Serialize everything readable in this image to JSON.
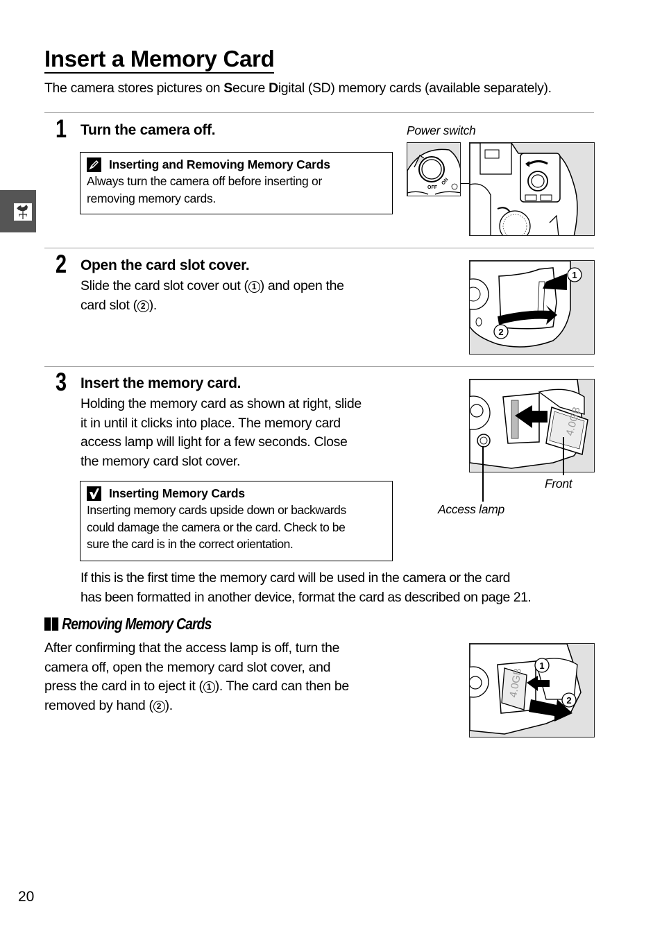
{
  "page": {
    "title": "Insert a Memory Card",
    "intro": {
      "part1": "The camera stores pictures on ",
      "s_letter": "S",
      "part2": "ecure ",
      "d_letter": "D",
      "part3": "igital (SD) memory cards (available separately)."
    },
    "side_tab": {
      "icon": "weathervane-icon"
    },
    "page_number": "20"
  },
  "steps": [
    {
      "number": "1",
      "title": "Turn the camera off.",
      "note": {
        "icon": "pencil-note-icon",
        "heading": "Inserting and Removing Memory Cards",
        "lines": [
          "Always turn the camera off before inserting or",
          "removing memory cards."
        ]
      },
      "figure": {
        "caption": "Power switch",
        "labels": [
          "OFF",
          "ON"
        ]
      }
    },
    {
      "number": "2",
      "title": "Open the card slot cover.",
      "text_parts": [
        "Slide the card slot cover out (",
        "1",
        ") and open the",
        "card slot (",
        "2",
        ")."
      ],
      "figure": {
        "callouts": [
          "1",
          "2"
        ]
      }
    },
    {
      "number": "3",
      "title": "Insert the memory card.",
      "lines": [
        "Holding the memory card as shown at right, slide",
        "it in until it clicks into place.  The memory card",
        "access lamp will light for a few seconds.  Close",
        "the memory card slot cover."
      ],
      "note": {
        "icon": "checkmark-caution-icon",
        "heading": "Inserting Memory Cards",
        "lines": [
          "Inserting memory cards upside down or backwards",
          "could damage the camera or the card.  Check to be",
          "sure the card is in the correct orientation."
        ]
      },
      "figure": {
        "label_front": "Front",
        "label_access_lamp": "Access lamp",
        "card_text": "4.0GB"
      },
      "after_lines": [
        "If this is the first time the memory card will be used in the camera or the card",
        "has been formatted in another device, format the card as described on page 21."
      ]
    }
  ],
  "removing": {
    "heading": "Removing Memory Cards",
    "text_parts": [
      "After confirming that the access lamp is off, turn the",
      "camera off, open the memory card slot cover, and",
      "press the card in to eject it (",
      "1",
      ").  The card can then be",
      "removed by hand (",
      "2",
      ")."
    ],
    "figure": {
      "callouts": [
        "1",
        "2"
      ],
      "card_text": "4.0GB"
    }
  }
}
